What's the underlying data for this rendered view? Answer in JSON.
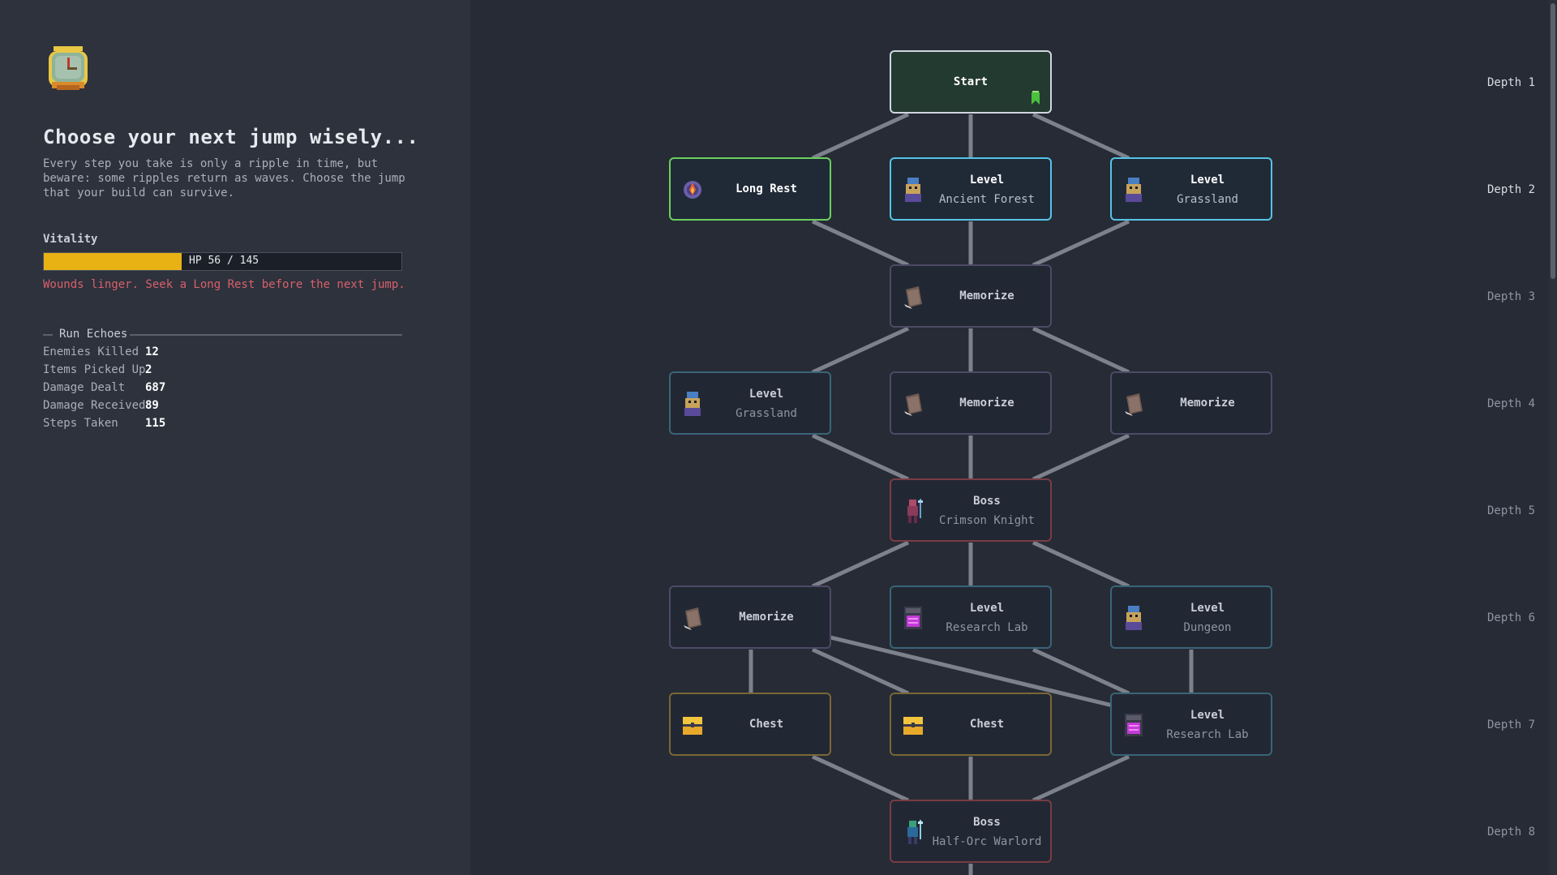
{
  "sidebar": {
    "title": "Choose your next jump wisely...",
    "description": "Every step you take is only a ripple in time, but beware: some ripples return as waves. Choose the jump that your build can survive.",
    "vitality_label": "Vitality",
    "hp_text": "HP 56 / 145",
    "hp_current": 56,
    "hp_max": 145,
    "warning": "Wounds linger. Seek a Long Rest before the next jump.",
    "echoes_title": "Run Echoes",
    "stats": [
      {
        "label": "Enemies Killed",
        "value": "12"
      },
      {
        "label": "Items Picked Up",
        "value": "2"
      },
      {
        "label": "Damage Dealt",
        "value": "687"
      },
      {
        "label": "Damage Received",
        "value": "89"
      },
      {
        "label": "Steps Taken",
        "value": "115"
      }
    ]
  },
  "map": {
    "depths": [
      "Depth 1",
      "Depth 2",
      "Depth 3",
      "Depth 4",
      "Depth 5",
      "Depth 6",
      "Depth 7",
      "Depth 8"
    ],
    "nodes": {
      "start": {
        "title": "Start"
      },
      "d2_rest": {
        "title": "Long Rest"
      },
      "d2_level1": {
        "title": "Level",
        "sub": "Ancient Forest"
      },
      "d2_level2": {
        "title": "Level",
        "sub": "Grassland"
      },
      "d3_memorize": {
        "title": "Memorize"
      },
      "d4_level": {
        "title": "Level",
        "sub": "Grassland"
      },
      "d4_memorize1": {
        "title": "Memorize"
      },
      "d4_memorize2": {
        "title": "Memorize"
      },
      "d5_boss": {
        "title": "Boss",
        "sub": "Crimson Knight"
      },
      "d6_memorize": {
        "title": "Memorize"
      },
      "d6_level1": {
        "title": "Level",
        "sub": "Research Lab"
      },
      "d6_level2": {
        "title": "Level",
        "sub": "Dungeon"
      },
      "d7_chest1": {
        "title": "Chest"
      },
      "d7_chest2": {
        "title": "Chest"
      },
      "d7_level": {
        "title": "Level",
        "sub": "Research Lab"
      },
      "d8_boss": {
        "title": "Boss",
        "sub": "Half-Orc Warlord"
      }
    }
  },
  "colors": {
    "hp_fill": "#e8b215",
    "warning": "#d9606c",
    "rest_border": "#6ccf5e",
    "active_border": "#56c4e6",
    "boss_border": "#7a3c45",
    "chest_border": "#7a6735"
  }
}
